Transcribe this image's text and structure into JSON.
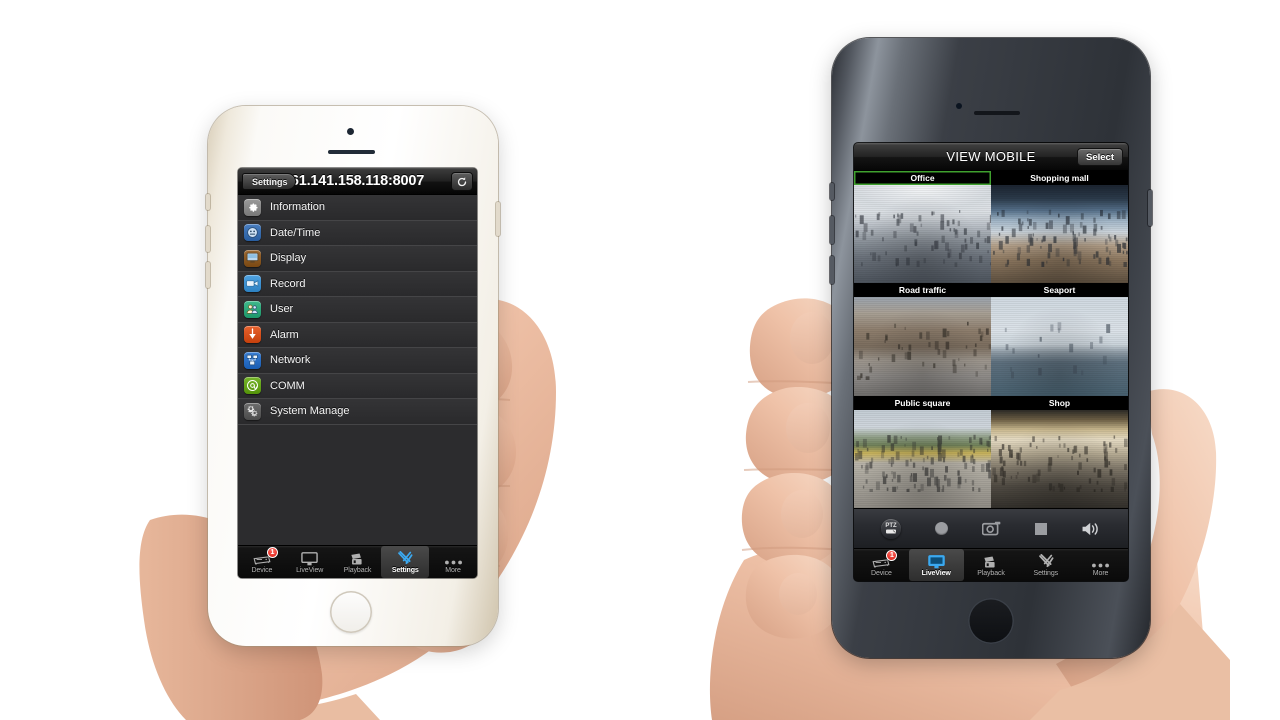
{
  "scene": {
    "background_color": "#ffffff",
    "description": "Two hands each holding an iPhone showing a CCTV/DVR mobile surveillance app"
  },
  "left_phone": {
    "device_name": "iphone-white-gold",
    "hardware": {
      "camera_icon": "front-camera",
      "earpiece_icon": "earpiece-speaker",
      "home_button_icon": "home-button"
    },
    "nav": {
      "back_label": "Settings",
      "title": "61.141.158.118:8007",
      "refresh_icon": "refresh-icon"
    },
    "settings": [
      {
        "label": "Information",
        "icon": "gear-icon",
        "color": "#9a9a9a"
      },
      {
        "label": "Date/Time",
        "icon": "clock-icon",
        "color": "#4a7fc1"
      },
      {
        "label": "Display",
        "icon": "display-icon",
        "color": "#9c6a34"
      },
      {
        "label": "Record",
        "icon": "camcorder-icon",
        "color": "#4fa3e3"
      },
      {
        "label": "User",
        "icon": "users-icon",
        "color": "#3fb98c"
      },
      {
        "label": "Alarm",
        "icon": "alarm-bell-icon",
        "color": "#e8622e"
      },
      {
        "label": "Network",
        "icon": "network-icon",
        "color": "#3a7fd5"
      },
      {
        "label": "COMM",
        "icon": "at-sign-icon",
        "color": "#76b52b"
      },
      {
        "label": "System Manage",
        "icon": "system-gears-icon",
        "color": "#6d6d6d"
      }
    ],
    "tabs": [
      {
        "label": "Device",
        "icon": "dvr-icon",
        "active": false,
        "badge": "1"
      },
      {
        "label": "LiveView",
        "icon": "monitor-icon",
        "active": false,
        "badge": ""
      },
      {
        "label": "Playback",
        "icon": "film-icon",
        "active": false,
        "badge": ""
      },
      {
        "label": "Settings",
        "icon": "tools-icon",
        "active": true,
        "badge": ""
      },
      {
        "label": "More",
        "icon": "ellipsis-icon",
        "active": false,
        "badge": ""
      }
    ]
  },
  "right_phone": {
    "device_name": "iphone-space-gray",
    "hardware": {
      "camera_icon": "front-camera",
      "earpiece_icon": "earpiece-speaker",
      "home_button_icon": "home-button"
    },
    "nav": {
      "title": "VIEW MOBILE",
      "select_label": "Select"
    },
    "cameras": [
      {
        "label": "Office",
        "scene": "scene-office",
        "selected": true
      },
      {
        "label": "Shopping mall",
        "scene": "scene-mall",
        "selected": false
      },
      {
        "label": "Road traffic",
        "scene": "scene-road",
        "selected": false
      },
      {
        "label": "Seaport",
        "scene": "scene-seaport",
        "selected": false
      },
      {
        "label": "Public square",
        "scene": "scene-square",
        "selected": false
      },
      {
        "label": "Shop",
        "scene": "scene-shop",
        "selected": false
      }
    ],
    "selection_color": "#3fa02e",
    "controls": [
      {
        "icon": "ptz-icon",
        "label": "PTZ"
      },
      {
        "icon": "record-icon",
        "label": ""
      },
      {
        "icon": "snapshot-icon",
        "label": ""
      },
      {
        "icon": "stop-icon",
        "label": ""
      },
      {
        "icon": "speaker-icon",
        "label": ""
      }
    ],
    "tabs": [
      {
        "label": "Device",
        "icon": "dvr-icon",
        "active": false,
        "badge": "1"
      },
      {
        "label": "LiveView",
        "icon": "monitor-icon",
        "active": true,
        "badge": ""
      },
      {
        "label": "Playback",
        "icon": "film-icon",
        "active": false,
        "badge": ""
      },
      {
        "label": "Settings",
        "icon": "tools-icon",
        "active": false,
        "badge": ""
      },
      {
        "label": "More",
        "icon": "ellipsis-icon",
        "active": false,
        "badge": ""
      }
    ]
  }
}
